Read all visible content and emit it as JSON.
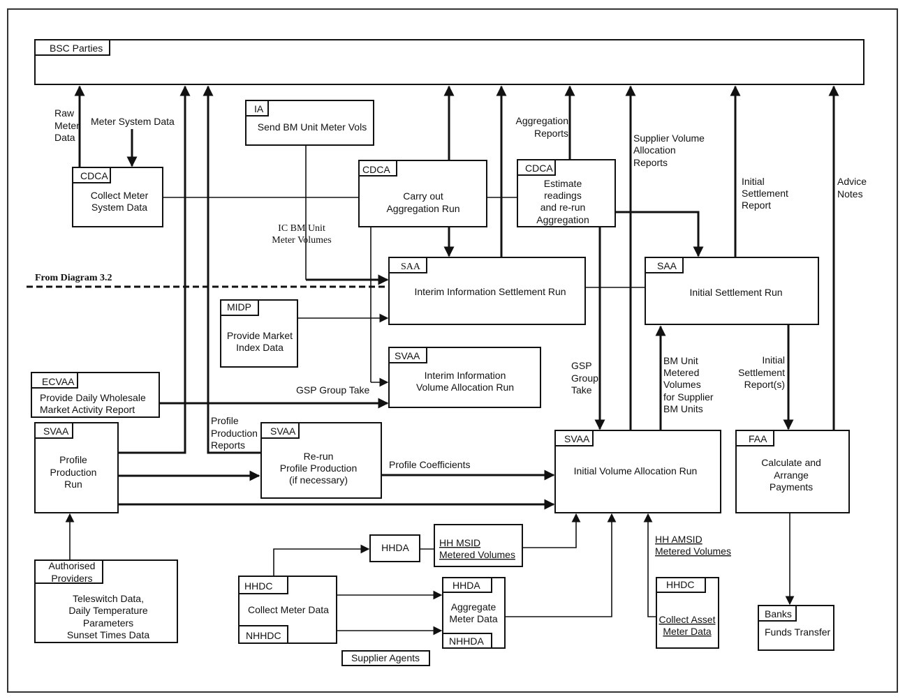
{
  "diagram": {
    "boundary_note": "From Diagram 3.2",
    "boxes": {
      "bsc": {
        "tag": "BSC Parties",
        "lines": []
      },
      "cdca_collect": {
        "tag": "CDCA",
        "lines": [
          "Collect Meter",
          "System Data"
        ]
      },
      "ia": {
        "tag": "IA",
        "lines": [
          "Send BM Unit Meter Vols"
        ]
      },
      "cdca_agg": {
        "tag": "CDCA",
        "lines": [
          "Carry out",
          "Aggregation Run"
        ]
      },
      "cdca_est": {
        "tag": "CDCA",
        "lines": [
          "Estimate",
          "readings",
          "and re-run",
          "Aggregation"
        ]
      },
      "saa_interim": {
        "tag": "SAA",
        "lines": [
          "Interim Information Settlement Run"
        ]
      },
      "saa_initial": {
        "tag": "SAA",
        "lines": [
          "Initial Settlement Run"
        ]
      },
      "midp": {
        "tag": "MIDP",
        "lines": [
          "Provide Market",
          "Index Data"
        ]
      },
      "svaa_interim": {
        "tag": "SVAA",
        "lines": [
          "Interim Information",
          "Volume Allocation Run"
        ]
      },
      "ecvaa": {
        "tag": "ECVAA",
        "lines": [
          "Provide Daily Wholesale",
          "Market Activity Report"
        ]
      },
      "svaa_profile": {
        "tag": "SVAA",
        "lines": [
          "Profile",
          "Production",
          "Run"
        ]
      },
      "svaa_rerun": {
        "tag": "SVAA",
        "lines": [
          "Re-run",
          "Profile Production",
          "(if necessary)"
        ]
      },
      "svaa_initial": {
        "tag": "SVAA",
        "lines": [
          "Initial Volume Allocation Run"
        ]
      },
      "faa": {
        "tag": "FAA",
        "lines": [
          "Calculate and",
          "Arrange",
          "Payments"
        ]
      },
      "auth": {
        "tag": [
          "Authorised",
          "Providers"
        ],
        "lines": [
          "Teleswitch Data,",
          "Daily Temperature",
          "Parameters",
          "Sunset Times Data"
        ]
      },
      "hhda_small": {
        "tag": "HHDA",
        "lines": []
      },
      "hhmsid": {
        "tag": "",
        "lines": [
          "HH MSID",
          "Metered Volumes"
        ]
      },
      "collect_meter": {
        "tag": "HHDC",
        "tag2": "NHHDC",
        "lines": [
          "Collect Meter Data"
        ]
      },
      "aggregate_meter": {
        "tag": "HHDA",
        "tag2": "NHHDA",
        "lines": [
          "Aggregate",
          "Meter Data"
        ]
      },
      "hhdc_asset": {
        "tag": "HHDC",
        "lines": [
          "Collect Asset",
          "Meter Data"
        ]
      },
      "banks": {
        "tag": "Banks",
        "lines": [
          "Funds Transfer"
        ]
      },
      "supplier_agents": {
        "tag": "Supplier Agents",
        "lines": []
      }
    },
    "flow_labels": {
      "raw_meter_data": [
        "Raw",
        "Meter",
        "Data"
      ],
      "meter_system_data": [
        "Meter System Data"
      ],
      "ic_bm_unit": [
        "IC BM Unit",
        "Meter Volumes"
      ],
      "aggregation_reports": [
        "Aggregation",
        "Reports"
      ],
      "supplier_volume_alloc": [
        "Supplier Volume",
        "Allocation",
        "Reports"
      ],
      "initial_settlement_report": [
        "Initial",
        "Settlement",
        "Report"
      ],
      "advice_notes": [
        "Advice",
        "Notes"
      ],
      "gsp_group_take_h": [
        "GSP Group Take"
      ],
      "gsp_group_take_v": [
        "GSP",
        "Group",
        "Take"
      ],
      "bm_unit_metered": [
        "BM Unit",
        "Metered",
        "Volumes",
        "for Supplier",
        "BM Units"
      ],
      "initial_settlement_reports": [
        "Initial",
        "Settlement",
        "Report(s)"
      ],
      "profile_production_reports": [
        "Profile",
        "Production",
        "Reports"
      ],
      "profile_coefficients": [
        "Profile Coefficients"
      ],
      "hh_amsid": [
        "HH AMSID",
        "Metered Volumes"
      ]
    }
  }
}
